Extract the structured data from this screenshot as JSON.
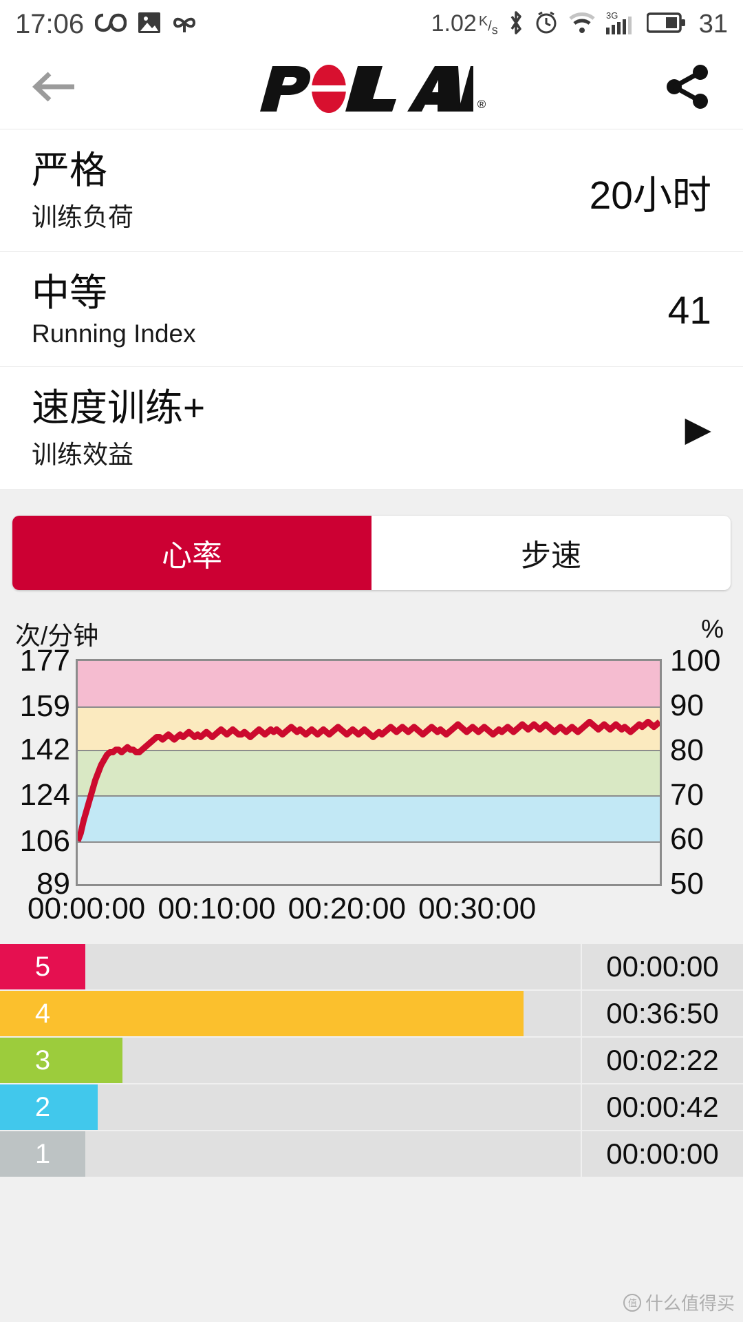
{
  "status_bar": {
    "time": "17:06",
    "icons_left": [
      "infinity-icon",
      "image-icon",
      "knot-icon"
    ],
    "network_speed": "1.02",
    "network_speed_unit_top": "K",
    "network_speed_unit_bottom": "s",
    "icons_right": [
      "bluetooth-icon",
      "alarm-icon",
      "wifi-icon",
      "signal-3g-icon",
      "battery-icon"
    ],
    "signal_label": "3G",
    "battery_percent": "31"
  },
  "appbar": {
    "back_icon": "back-arrow-icon",
    "brand": "POLAR",
    "brand_registered": "®",
    "share_icon": "share-icon"
  },
  "rows": [
    {
      "title": "严格",
      "subtitle": "训练负荷",
      "value": "20小时",
      "arrow": ""
    },
    {
      "title": "中等",
      "subtitle": "Running Index",
      "value": "41",
      "arrow": ""
    },
    {
      "title": "速度训练+",
      "subtitle": "训练效益",
      "value": "",
      "arrow": "▶"
    }
  ],
  "tabs": [
    {
      "label": "心率",
      "active": true
    },
    {
      "label": "步速",
      "active": false
    }
  ],
  "colors": {
    "brand_red": "#cc0033",
    "hr_line": "#cc0a2e",
    "zone5": "#e51050",
    "zone4": "#fbc02d",
    "zone3": "#9ccc3c",
    "zone2": "#41c8ec",
    "zone1": "#bdc3c4",
    "band5": "#f5bcd0",
    "band4": "#fbeabf",
    "band3": "#d9e8c4",
    "band2": "#c2e8f5",
    "band1": "#eeeeee"
  },
  "chart_data": {
    "type": "line",
    "title": "",
    "ylabel_left": "次/分钟",
    "ylabel_right": "%",
    "xlabel": "",
    "yticks_left": [
      177,
      159,
      142,
      124,
      106,
      89
    ],
    "yticks_right": [
      100,
      90,
      80,
      70,
      60,
      50
    ],
    "ylim_left": [
      89,
      177
    ],
    "ylim_right": [
      50,
      100
    ],
    "xticks": [
      "00:00:00",
      "00:10:00",
      "00:20:00",
      "00:30:00"
    ],
    "xlim_seconds": [
      0,
      2400
    ],
    "grid": true,
    "legend_position": "none",
    "zone_bands": [
      {
        "zone": 5,
        "from": 159,
        "to": 177,
        "color": "#f5bcd0"
      },
      {
        "zone": 4,
        "from": 142,
        "to": 159,
        "color": "#fbeabf"
      },
      {
        "zone": 3,
        "from": 124,
        "to": 142,
        "color": "#d9e8c4"
      },
      {
        "zone": 2,
        "from": 106,
        "to": 124,
        "color": "#c2e8f5"
      },
      {
        "zone": 1,
        "from": 89,
        "to": 106,
        "color": "#eeeeee"
      }
    ],
    "series": [
      {
        "name": "心率",
        "color": "#cc0a2e",
        "values": [
          106,
          109,
          114,
          118,
          122,
          126,
          130,
          133,
          136,
          138,
          140,
          141,
          141,
          142,
          142,
          141,
          142,
          143,
          142,
          142,
          141,
          141,
          142,
          143,
          144,
          145,
          146,
          147,
          147,
          146,
          147,
          148,
          147,
          146,
          147,
          148,
          147,
          148,
          149,
          148,
          147,
          148,
          147,
          148,
          149,
          148,
          147,
          148,
          149,
          150,
          149,
          148,
          149,
          150,
          149,
          148,
          148,
          149,
          148,
          147,
          148,
          149,
          150,
          149,
          148,
          149,
          150,
          149,
          150,
          149,
          148,
          149,
          150,
          151,
          150,
          149,
          150,
          149,
          148,
          149,
          150,
          149,
          148,
          149,
          150,
          149,
          148,
          149,
          150,
          151,
          150,
          149,
          148,
          149,
          150,
          149,
          148,
          149,
          150,
          149,
          148,
          147,
          148,
          149,
          148,
          149,
          150,
          151,
          150,
          149,
          150,
          151,
          150,
          149,
          150,
          151,
          150,
          149,
          148,
          149,
          150,
          151,
          150,
          149,
          150,
          149,
          148,
          149,
          150,
          151,
          152,
          151,
          150,
          149,
          150,
          151,
          150,
          149,
          150,
          151,
          150,
          149,
          148,
          149,
          150,
          149,
          150,
          151,
          150,
          149,
          150,
          151,
          152,
          151,
          150,
          151,
          152,
          151,
          150,
          151,
          152,
          151,
          150,
          149,
          150,
          151,
          150,
          149,
          150,
          151,
          150,
          149,
          150,
          151,
          152,
          153,
          152,
          151,
          150,
          151,
          152,
          151,
          150,
          151,
          152,
          151,
          150,
          151,
          150,
          149,
          150,
          151,
          152,
          151,
          152,
          153,
          152,
          151,
          152,
          153
        ]
      }
    ]
  },
  "zone_table": {
    "rows": [
      {
        "zone": "5",
        "time": "00:00:00",
        "fill_percent": 0,
        "color": "#e51050"
      },
      {
        "zone": "4",
        "time": "00:36:50",
        "fill_percent": 88.5,
        "color": "#fbc02d"
      },
      {
        "zone": "3",
        "time": "00:02:22",
        "fill_percent": 7.5,
        "color": "#9ccc3c"
      },
      {
        "zone": "2",
        "time": "00:00:42",
        "fill_percent": 2.5,
        "color": "#41c8ec"
      },
      {
        "zone": "1",
        "time": "00:00:00",
        "fill_percent": 0,
        "color": "#bdc3c4"
      }
    ]
  },
  "watermark": "什么值得买"
}
